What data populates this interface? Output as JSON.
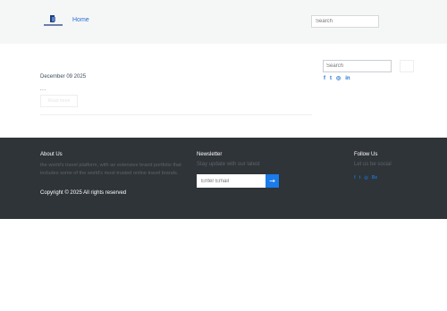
{
  "header": {
    "nav": {
      "home_label": "Home"
    },
    "search": {
      "placeholder": "Search"
    }
  },
  "post": {
    "date": "December 09 2025",
    "excerpt": "...",
    "read_more_label": "Read more"
  },
  "sidebar": {
    "search": {
      "placeholder": "Search"
    },
    "social": [
      {
        "icon": "facebook-icon",
        "glyph": "f"
      },
      {
        "icon": "twitter-icon",
        "glyph": "t"
      },
      {
        "icon": "instagram-icon",
        "glyph": "◎"
      },
      {
        "icon": "linkedin-icon",
        "glyph": "in"
      }
    ]
  },
  "footer": {
    "about": {
      "title": "About Us",
      "text": "the world's travel platform, with an extensive brand portfolio that includes some of the world's most trusted online travel brands.",
      "copyright": "Copyright © 2025 All rights reserved"
    },
    "newsletter": {
      "title": "Newsletter",
      "subtitle": "Stay update with our latest",
      "email_placeholder": "Enter Email",
      "submit_glyph": "→"
    },
    "follow": {
      "title": "Follow Us",
      "subtitle": "Let us be social",
      "social": [
        {
          "icon": "facebook-icon",
          "glyph": "f"
        },
        {
          "icon": "twitter-icon",
          "glyph": "t"
        },
        {
          "icon": "instagram-icon",
          "glyph": "◎"
        },
        {
          "icon": "behance-icon",
          "glyph": "Be"
        }
      ]
    }
  },
  "colors": {
    "accent": "#1b7be8",
    "link": "#2a6fd1",
    "header_bg": "#f5f6f6",
    "footer_bg": "#2f3438"
  }
}
